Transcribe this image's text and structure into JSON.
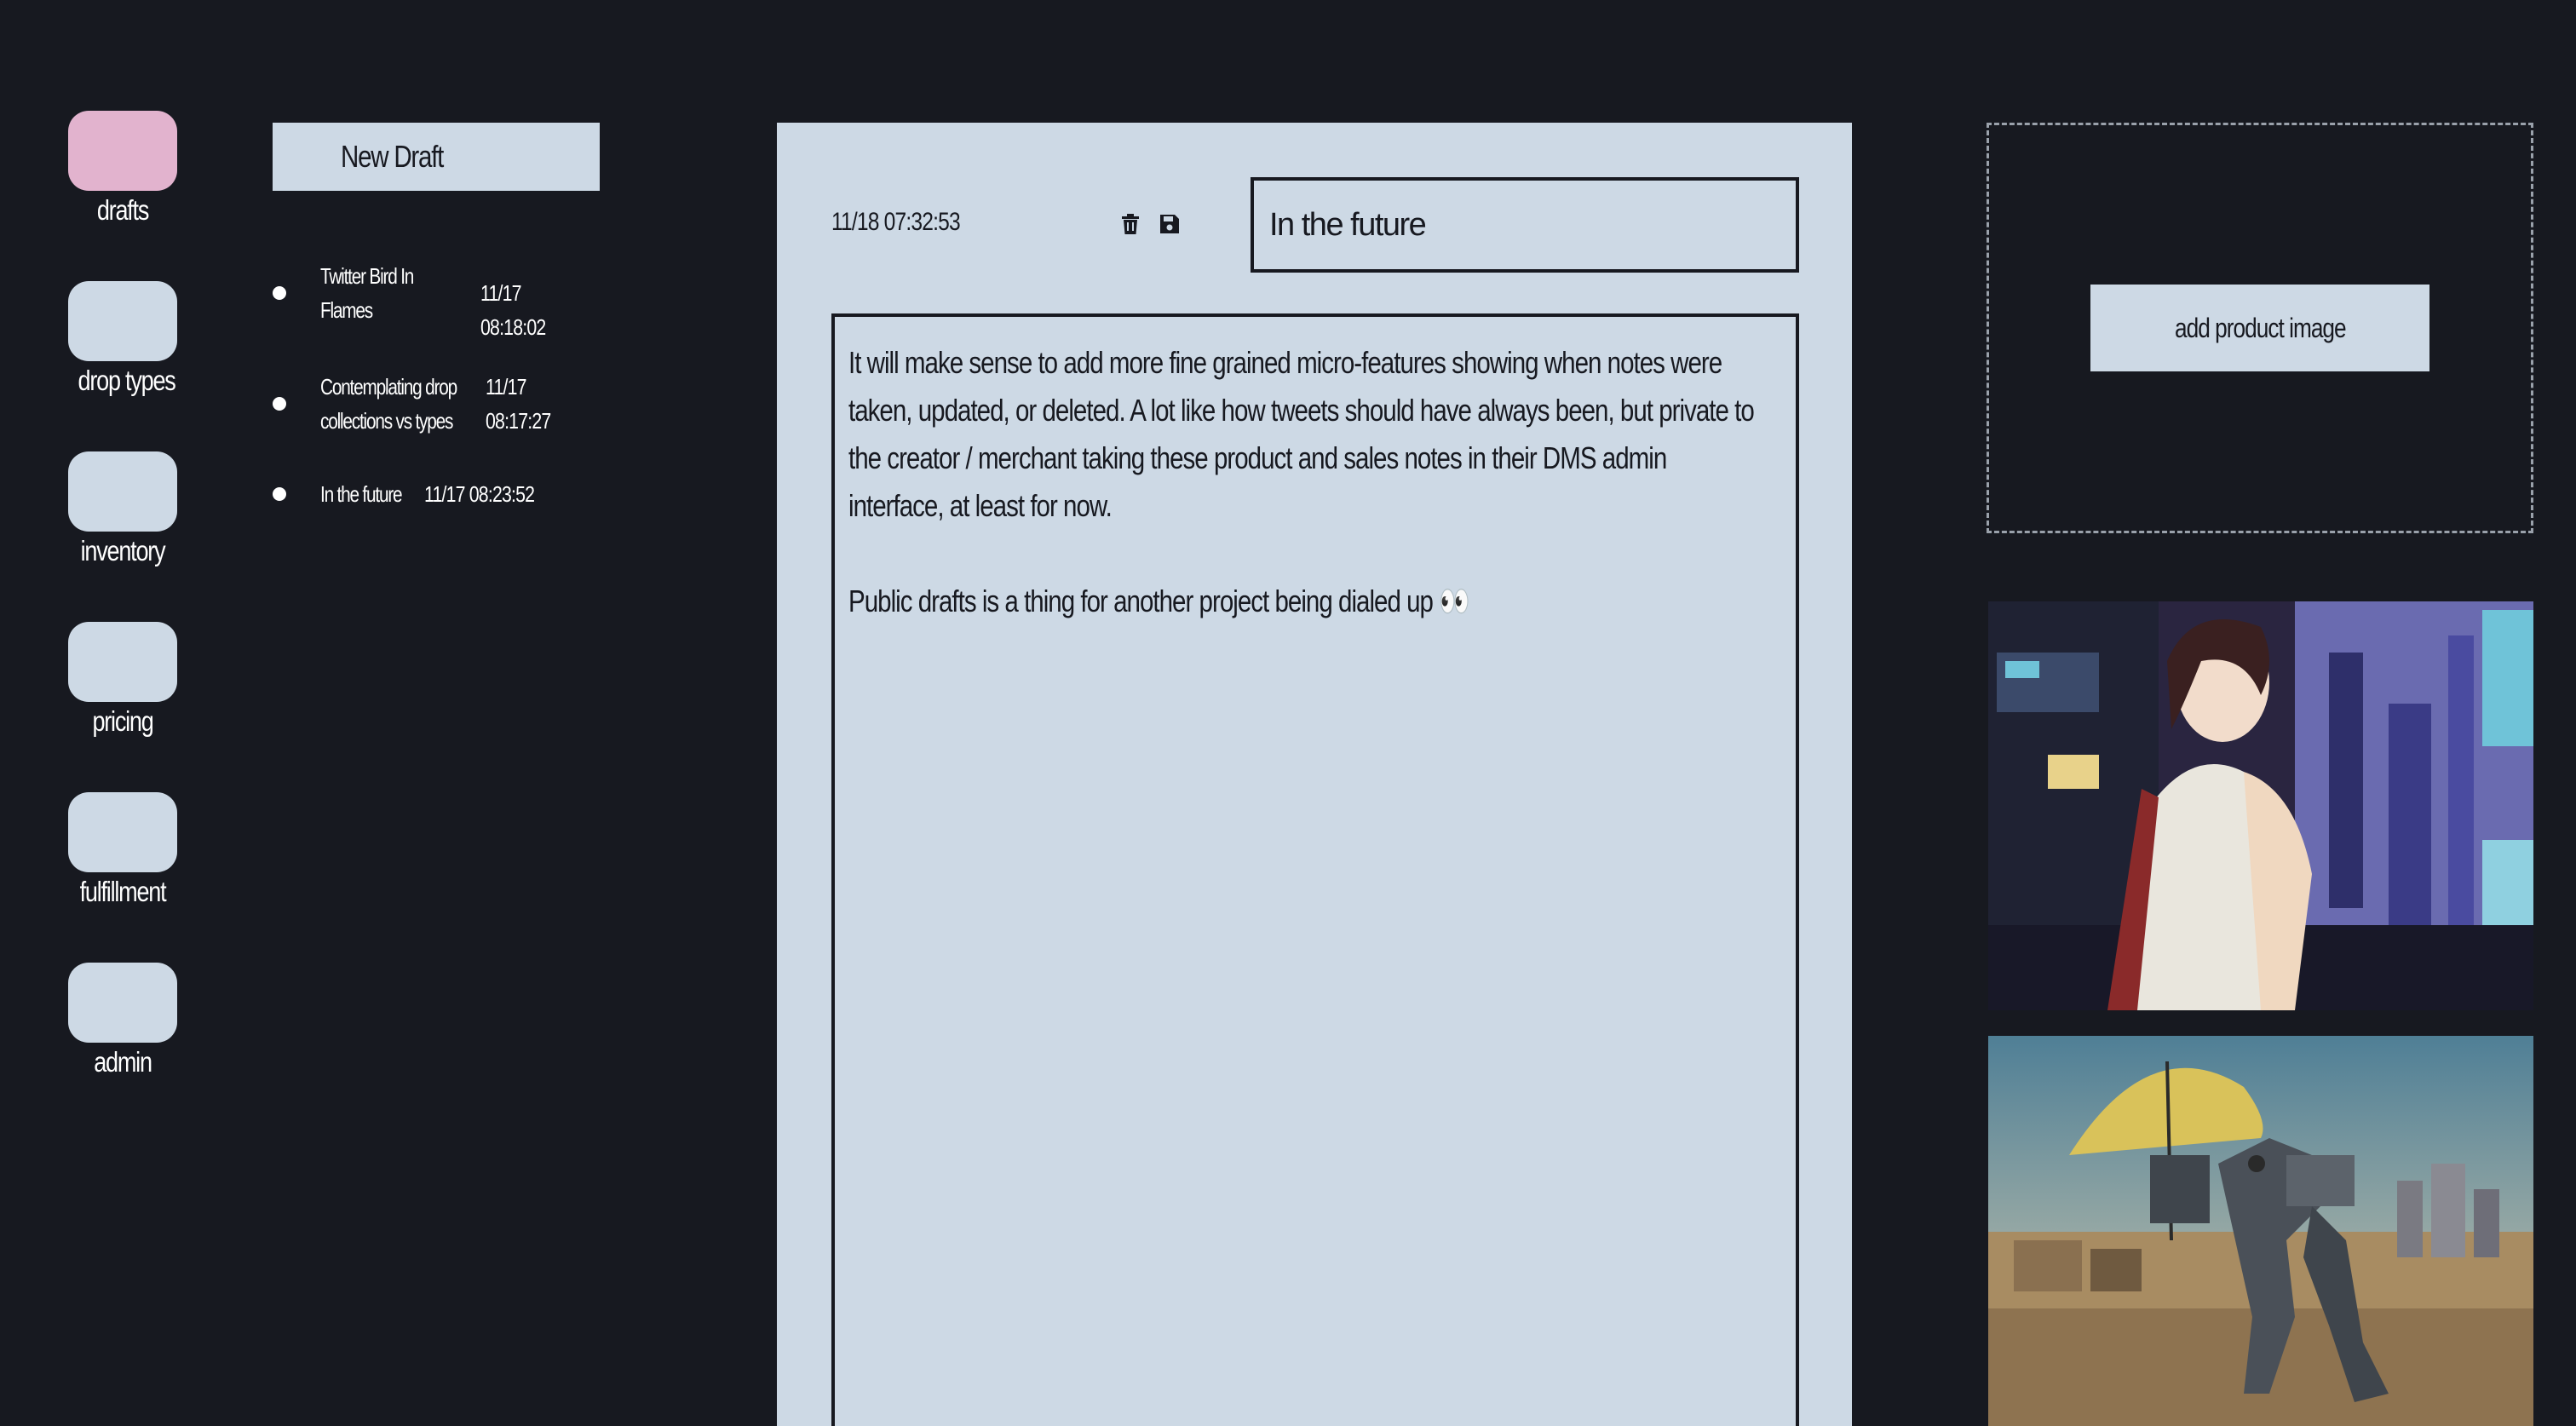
{
  "nav": {
    "items": [
      {
        "label": "drafts",
        "active": true
      },
      {
        "label": "drop types",
        "active": false
      },
      {
        "label": "inventory",
        "active": false
      },
      {
        "label": "pricing",
        "active": false
      },
      {
        "label": "fulfillment",
        "active": false
      },
      {
        "label": "admin",
        "active": false
      }
    ]
  },
  "drafts": {
    "new_label": "New Draft",
    "items": [
      {
        "title_line1": "Twitter Bird In",
        "title_line2": "Flames",
        "time_line1": "11/17 08:18:02",
        "time_line2": ""
      },
      {
        "title_line1": "Contemplating drop",
        "title_line2": "collections vs types",
        "time_line1": "11/17",
        "time_line2": "08:17:27"
      },
      {
        "title_line1": "In the future",
        "title_line2": "",
        "time_line1": "11/17 08:23:52",
        "time_line2": ""
      }
    ]
  },
  "editor": {
    "timestamp": "11/18 07:32:53",
    "delete_icon": "trash-icon",
    "save_icon": "floppy-disk-icon",
    "title_value": "In the future",
    "body": [
      "It will make sense to add more fine grained micro-features showing when notes were taken, updated, or deleted. A lot like how tweets should have always been, but private to the creator / merchant taking these product and sales notes in their DMS admin interface, at least for now.",
      "Public drafts is a thing for another project being dialed up 👀"
    ]
  },
  "product": {
    "add_image_label": "add product image"
  },
  "colors": {
    "background": "#171920",
    "panel": "#cdd9e5",
    "accent_active": "#e2b3ce",
    "ink": "#171920"
  }
}
